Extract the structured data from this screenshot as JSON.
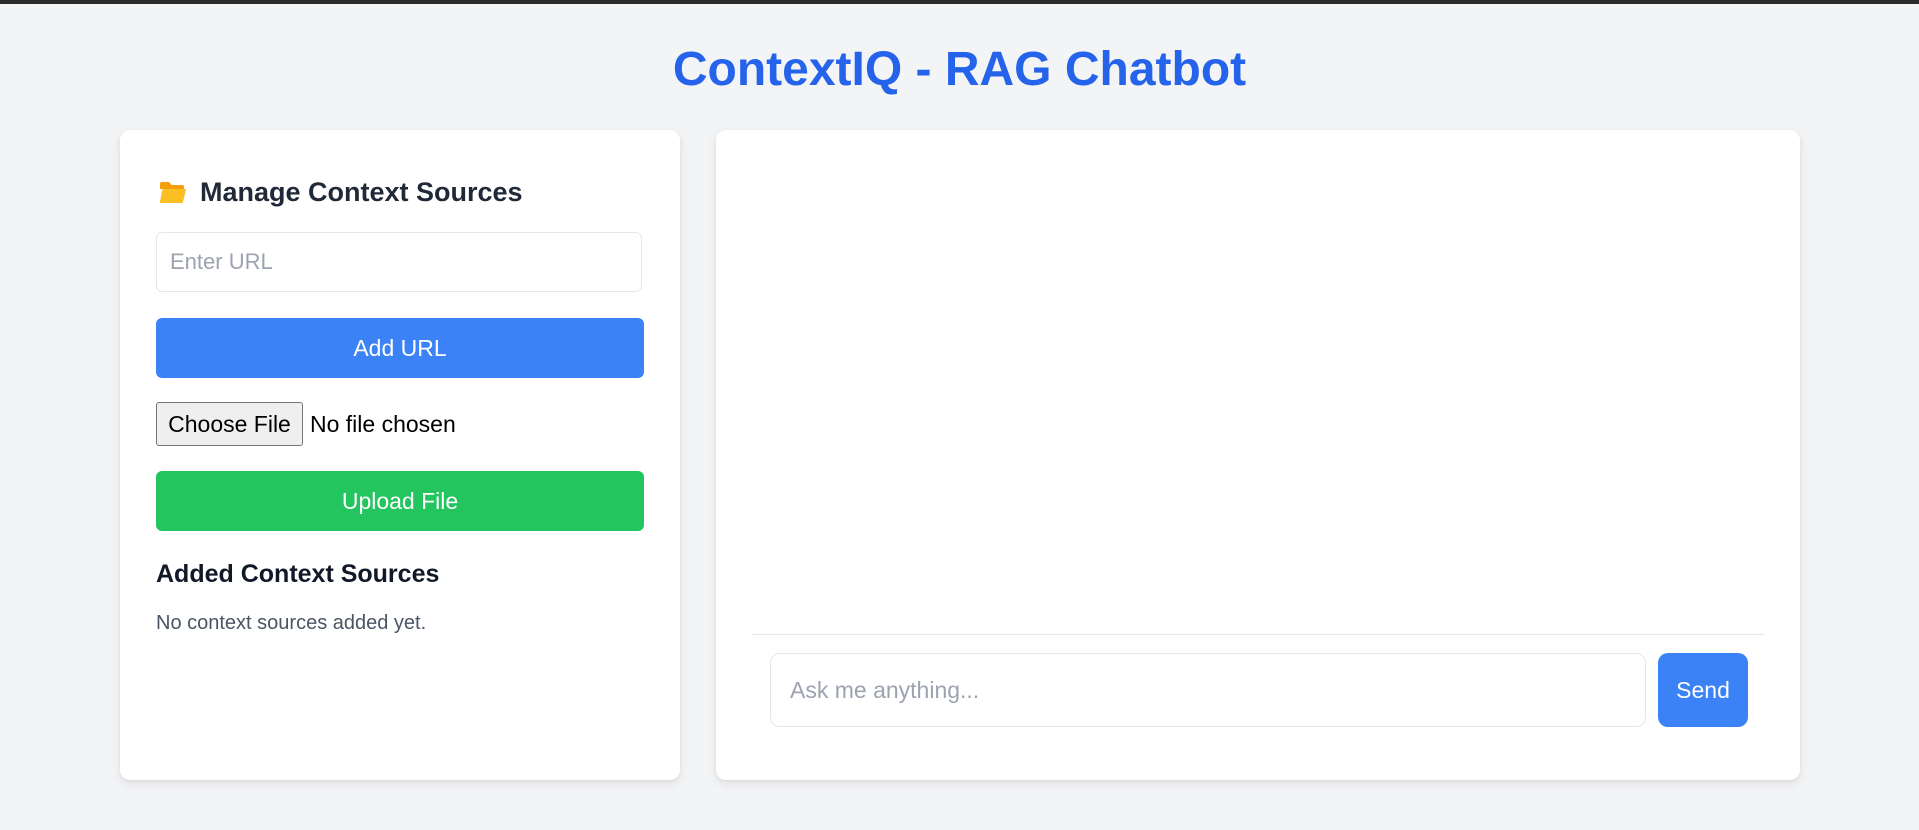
{
  "app": {
    "title": "ContextIQ - RAG Chatbot"
  },
  "sidebar": {
    "heading": "Manage Context Sources",
    "heading_icon": "folder-icon",
    "url_input": {
      "placeholder": "Enter URL",
      "value": ""
    },
    "add_url_label": "Add URL",
    "choose_file_label": "Choose File",
    "file_status": "No file chosen",
    "upload_label": "Upload File",
    "added_heading": "Added Context Sources",
    "empty_message": "No context sources added yet."
  },
  "chat": {
    "messages": [],
    "input": {
      "placeholder": "Ask me anything...",
      "value": ""
    },
    "send_label": "Send"
  },
  "colors": {
    "title": "#2563eb",
    "primary_button": "#3b82f6",
    "upload_button": "#22c55e",
    "background": "#f3f4f6",
    "card": "#ffffff",
    "folder_icon": "#fbbf24"
  }
}
